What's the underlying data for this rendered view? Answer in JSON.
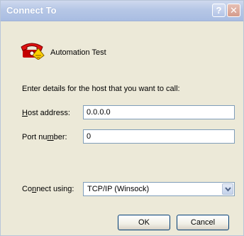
{
  "window": {
    "title": "Connect To",
    "help_glyph": "?",
    "close_glyph": "✕"
  },
  "connection": {
    "name": "Automation Test",
    "icon": "phone-icon"
  },
  "prompt": "Enter details for the host that you want to call:",
  "host": {
    "label_pre": "",
    "label_key": "H",
    "label_post": "ost address:",
    "value": "0.0.0.0"
  },
  "port": {
    "label_pre": "Port nu",
    "label_key": "m",
    "label_post": "ber:",
    "value": "0"
  },
  "connect_using": {
    "label_pre": "Co",
    "label_key": "n",
    "label_post": "nect using:",
    "value": "TCP/IP (Winsock)"
  },
  "buttons": {
    "ok": "OK",
    "cancel": "Cancel"
  }
}
